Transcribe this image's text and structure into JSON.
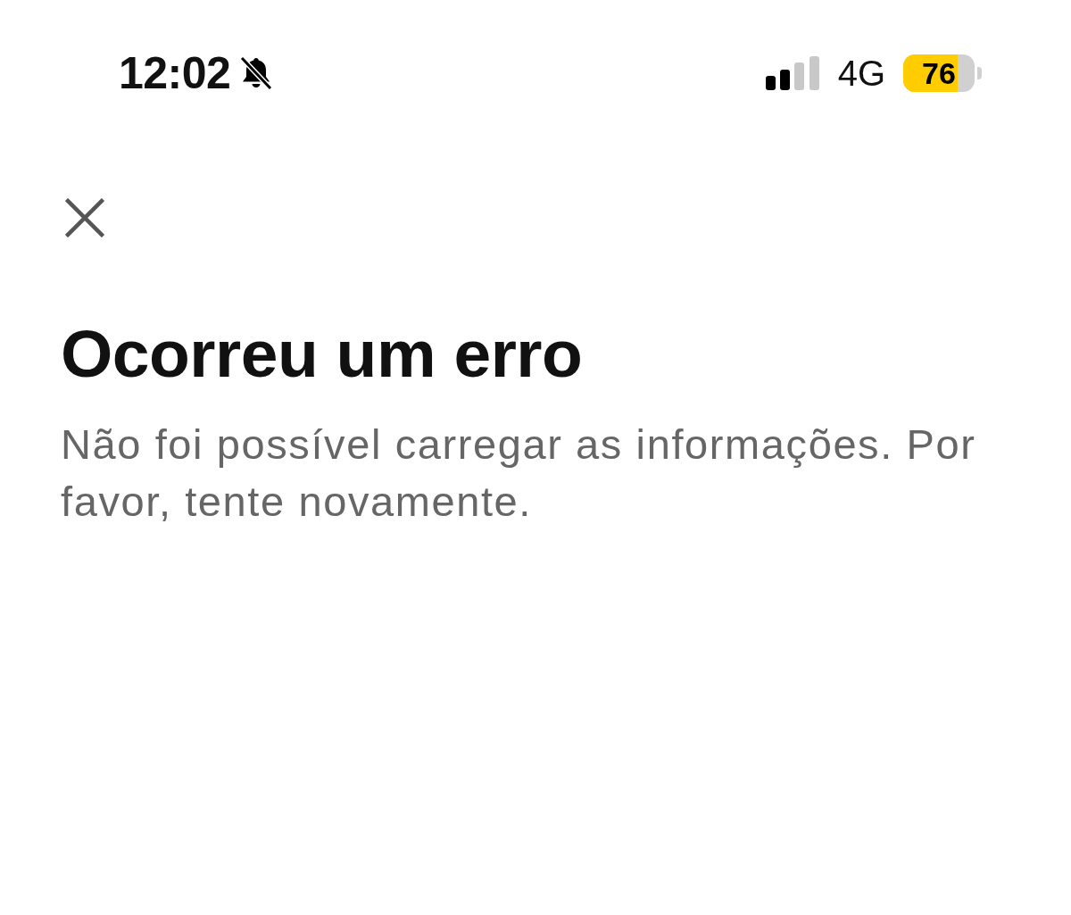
{
  "status_bar": {
    "time": "12:02",
    "network": "4G",
    "battery": "76"
  },
  "error": {
    "title": "Ocorreu um erro",
    "message": "Não foi possível carregar as informações. Por favor, tente novamente."
  }
}
